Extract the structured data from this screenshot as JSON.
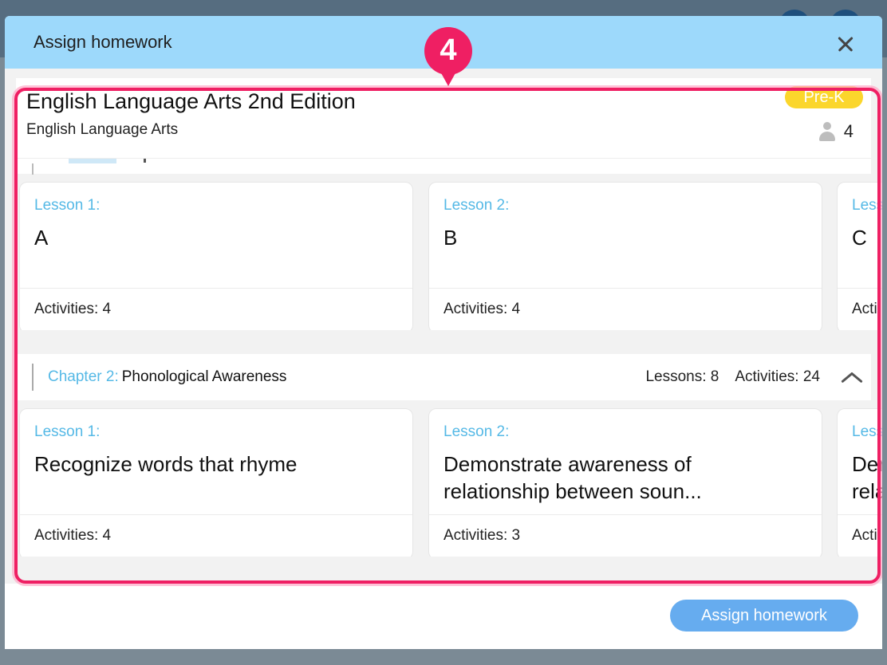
{
  "modal": {
    "title": "Assign homework"
  },
  "course": {
    "title": "English Language Arts 2nd Edition",
    "subject": "English Language Arts",
    "grade": "Pre-K",
    "student_count": "4"
  },
  "chapter1_lessons": [
    {
      "number": "Lesson 1:",
      "name": "A",
      "activities": "Activities: 4"
    },
    {
      "number": "Lesson 2:",
      "name": "B",
      "activities": "Activities: 4"
    },
    {
      "number": "Less",
      "name": "C",
      "activities": "Acti"
    }
  ],
  "chapter2": {
    "label": "Chapter 2:",
    "name": "Phonological Awareness",
    "lessons": "Lessons: 8",
    "activities": "Activities: 24",
    "lesson_cards": [
      {
        "number": "Lesson 1:",
        "name": "Recognize words that rhyme",
        "activities": "Activities: 4"
      },
      {
        "number": "Lesson 2:",
        "name": "Demonstrate awareness of relationship between soun...",
        "activities": "Activities: 3"
      },
      {
        "number": "Less",
        "name": "Der rela",
        "activities": "Acti"
      }
    ]
  },
  "annotation": {
    "marker": "4",
    "color": "#ef1f63"
  },
  "footer": {
    "assign_label": "Assign homework"
  }
}
